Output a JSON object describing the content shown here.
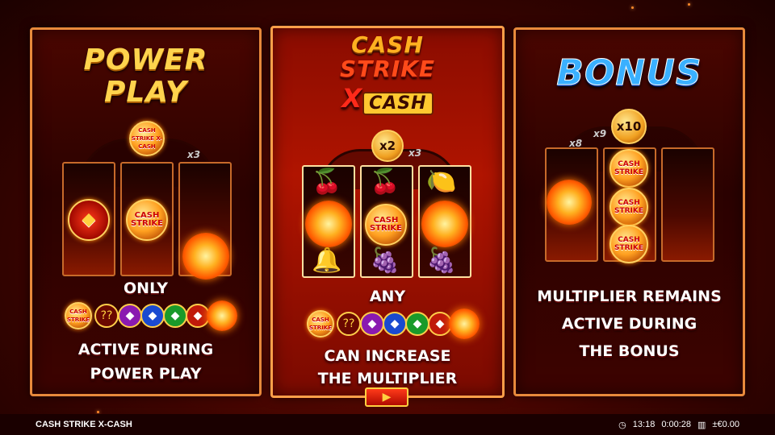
{
  "panels": {
    "left": {
      "logo_line1": "POWER",
      "logo_line2": "PLAY",
      "coin_text": "CASH STRIKE X-CASH",
      "arc_labels": [
        "x3"
      ],
      "reel_coin_text": "CASH STRIKE",
      "caption_top": "ONLY",
      "caption_line1": "ACTIVE DURING",
      "caption_line2": "POWER PLAY",
      "symbols": [
        "CASH STRIKE",
        "??",
        "gem-purple",
        "gem-blue",
        "gem-green",
        "gem-red",
        "sun"
      ]
    },
    "middle": {
      "logo_line1": "CASH",
      "logo_line2": "STRIKE",
      "logo_x": "X",
      "logo_cash": "CASH",
      "multiplier": "x2",
      "arc_labels": [
        "x3"
      ],
      "reel_coin_text": "CASH STRIKE",
      "caption_top": "ANY",
      "caption_line1": "CAN INCREASE",
      "caption_line2": "THE MULTIPLIER",
      "symbols": [
        "CASH STRIKE",
        "??",
        "gem-purple",
        "gem-blue",
        "gem-green",
        "gem-red",
        "sun"
      ],
      "play_icon": "play-arrow-icon"
    },
    "right": {
      "logo": "BONUS",
      "multiplier": "x10",
      "arc_labels": [
        "x8",
        "x9"
      ],
      "reel_coin_text": "CASH STRIKE",
      "caption_line1": "MULTIPLIER REMAINS",
      "caption_line2": "ACTIVE DURING",
      "caption_line3": "THE BONUS"
    }
  },
  "statusbar": {
    "game_title": "CASH STRIKE X-CASH",
    "clock": "13:18",
    "session_time": "0:00:28",
    "balance": "±€0.00"
  },
  "colors": {
    "panel_border": "#e88a3c",
    "caption_text": "#ffffff",
    "bonus_logo": "#3ab0ff",
    "power_logo": "#ffd34d"
  }
}
